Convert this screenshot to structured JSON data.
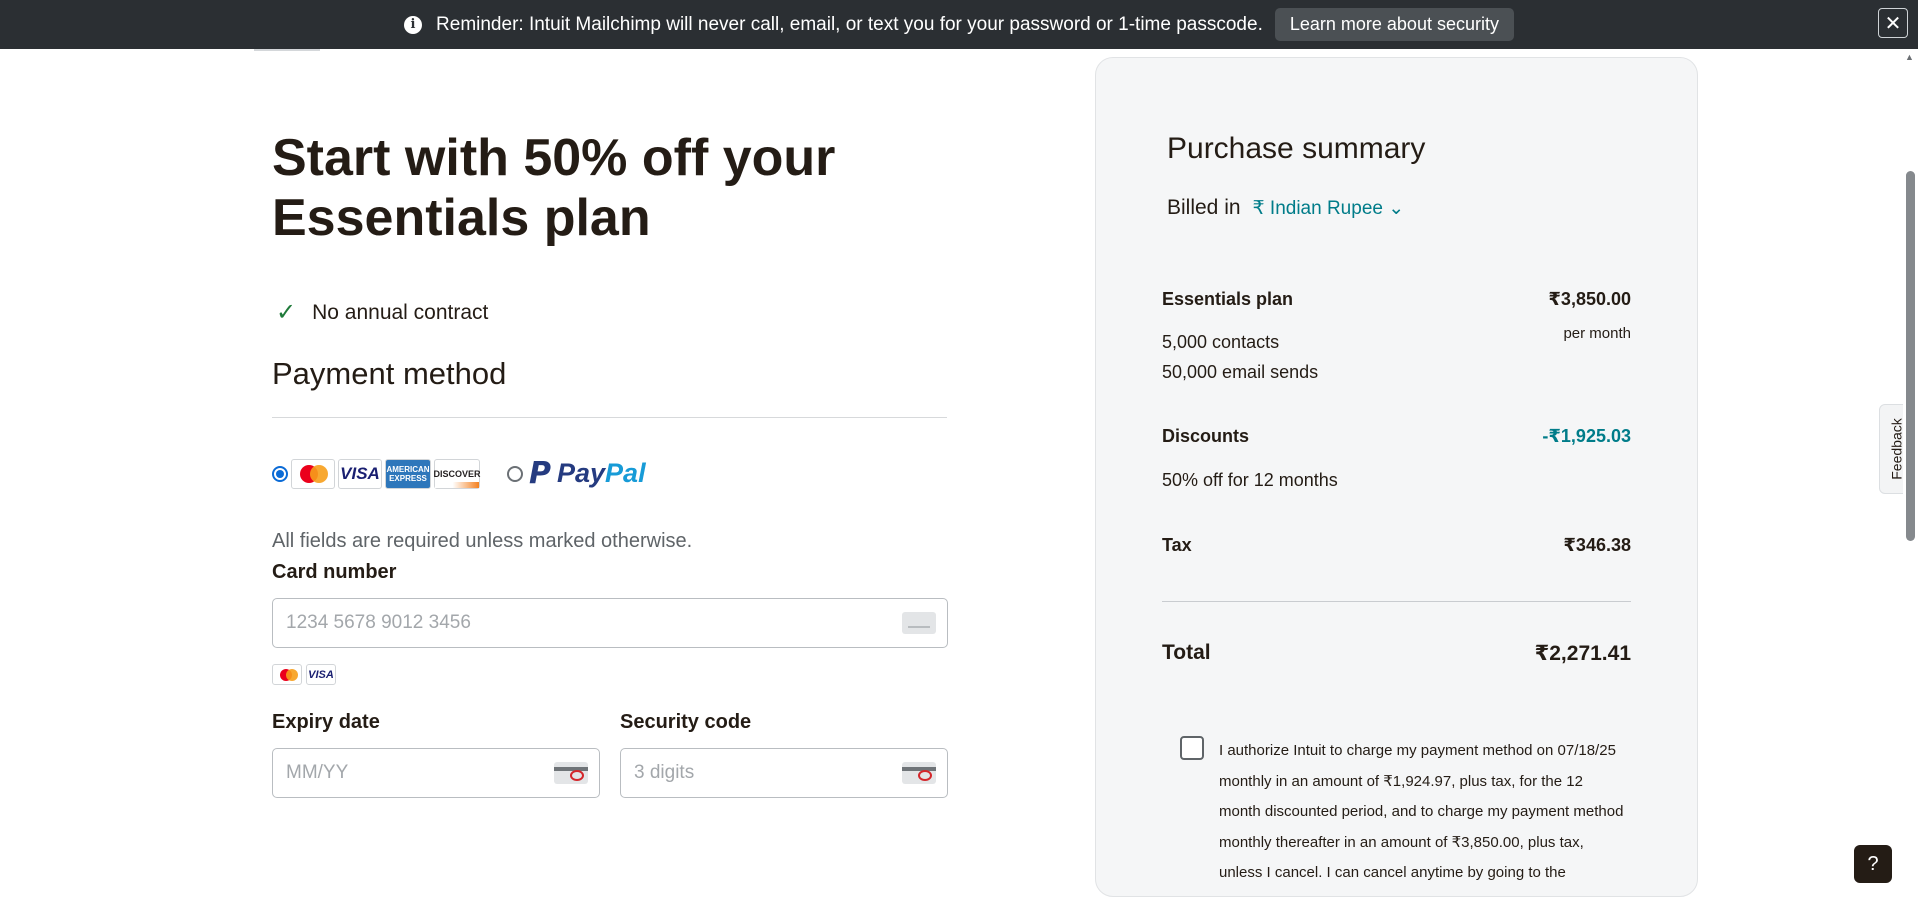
{
  "banner": {
    "message": "Reminder: Intuit Mailchimp will never call, email, or text you for your password or 1-time passcode.",
    "learn_more_label": "Learn more about security",
    "close_glyph": "✕"
  },
  "main": {
    "headline": "Start with 50% off your Essentials plan",
    "feature": "No annual contract",
    "payment_method_title": "Payment method",
    "paypal_label_pay": "Pay",
    "paypal_label_pal": "Pal",
    "required_note": "All fields are required unless marked otherwise.",
    "card_number_label": "Card number",
    "card_number_placeholder": "1234 5678 9012 3456",
    "expiry_label": "Expiry date",
    "expiry_placeholder": "MM/YY",
    "security_label": "Security code",
    "security_placeholder": "3 digits",
    "card_logos": {
      "visa": "VISA",
      "amex": "AMERICAN EXPRESS",
      "discover": "DISCOVER"
    }
  },
  "summary": {
    "title": "Purchase summary",
    "billed_in_label": "Billed in",
    "currency": "₹ Indian Rupee",
    "plan_name": "Essentials plan",
    "plan_price": "₹3,850.00",
    "plan_period": "per month",
    "contacts": "5,000 contacts",
    "email_sends": "50,000 email sends",
    "discounts_label": "Discounts",
    "discounts_value": "-₹1,925.03",
    "discount_desc": "50% off for 12 months",
    "tax_label": "Tax",
    "tax_value": "₹346.38",
    "total_label": "Total",
    "total_value": "₹2,271.41",
    "authorization_text": "I authorize Intuit to charge my payment method on 07/18/25 monthly in an amount of ₹1,924.97, plus tax, for the 12 month discounted period, and to charge my payment method monthly thereafter in an amount of ₹3,850.00, plus tax, unless I cancel.  I can cancel anytime by going to the"
  },
  "feedback_label": "Feedback",
  "help_label": "?",
  "colors": {
    "accent_teal": "#007c89",
    "banner_bg": "#2b2f33",
    "checkmark": "#1f7a3a",
    "radio_selected": "#0b6bd6"
  }
}
